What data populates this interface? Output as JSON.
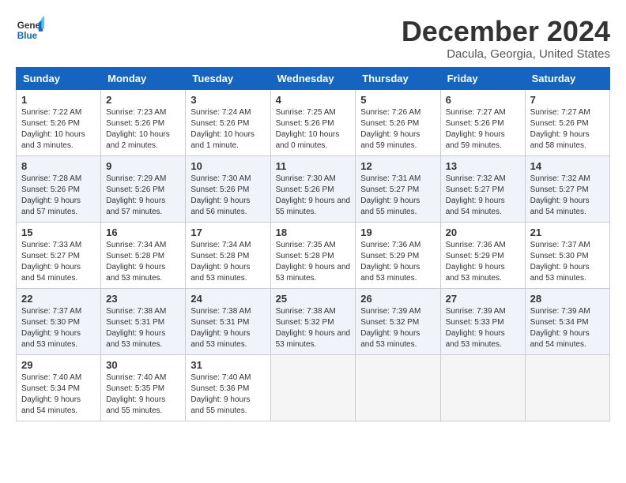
{
  "header": {
    "logo_general": "General",
    "logo_blue": "Blue",
    "month": "December 2024",
    "location": "Dacula, Georgia, United States"
  },
  "days_of_week": [
    "Sunday",
    "Monday",
    "Tuesday",
    "Wednesday",
    "Thursday",
    "Friday",
    "Saturday"
  ],
  "weeks": [
    [
      {
        "day": "1",
        "sunrise": "Sunrise: 7:22 AM",
        "sunset": "Sunset: 5:26 PM",
        "daylight": "Daylight: 10 hours and 3 minutes."
      },
      {
        "day": "2",
        "sunrise": "Sunrise: 7:23 AM",
        "sunset": "Sunset: 5:26 PM",
        "daylight": "Daylight: 10 hours and 2 minutes."
      },
      {
        "day": "3",
        "sunrise": "Sunrise: 7:24 AM",
        "sunset": "Sunset: 5:26 PM",
        "daylight": "Daylight: 10 hours and 1 minute."
      },
      {
        "day": "4",
        "sunrise": "Sunrise: 7:25 AM",
        "sunset": "Sunset: 5:26 PM",
        "daylight": "Daylight: 10 hours and 0 minutes."
      },
      {
        "day": "5",
        "sunrise": "Sunrise: 7:26 AM",
        "sunset": "Sunset: 5:26 PM",
        "daylight": "Daylight: 9 hours and 59 minutes."
      },
      {
        "day": "6",
        "sunrise": "Sunrise: 7:27 AM",
        "sunset": "Sunset: 5:26 PM",
        "daylight": "Daylight: 9 hours and 59 minutes."
      },
      {
        "day": "7",
        "sunrise": "Sunrise: 7:27 AM",
        "sunset": "Sunset: 5:26 PM",
        "daylight": "Daylight: 9 hours and 58 minutes."
      }
    ],
    [
      {
        "day": "8",
        "sunrise": "Sunrise: 7:28 AM",
        "sunset": "Sunset: 5:26 PM",
        "daylight": "Daylight: 9 hours and 57 minutes."
      },
      {
        "day": "9",
        "sunrise": "Sunrise: 7:29 AM",
        "sunset": "Sunset: 5:26 PM",
        "daylight": "Daylight: 9 hours and 57 minutes."
      },
      {
        "day": "10",
        "sunrise": "Sunrise: 7:30 AM",
        "sunset": "Sunset: 5:26 PM",
        "daylight": "Daylight: 9 hours and 56 minutes."
      },
      {
        "day": "11",
        "sunrise": "Sunrise: 7:30 AM",
        "sunset": "Sunset: 5:26 PM",
        "daylight": "Daylight: 9 hours and 55 minutes."
      },
      {
        "day": "12",
        "sunrise": "Sunrise: 7:31 AM",
        "sunset": "Sunset: 5:27 PM",
        "daylight": "Daylight: 9 hours and 55 minutes."
      },
      {
        "day": "13",
        "sunrise": "Sunrise: 7:32 AM",
        "sunset": "Sunset: 5:27 PM",
        "daylight": "Daylight: 9 hours and 54 minutes."
      },
      {
        "day": "14",
        "sunrise": "Sunrise: 7:32 AM",
        "sunset": "Sunset: 5:27 PM",
        "daylight": "Daylight: 9 hours and 54 minutes."
      }
    ],
    [
      {
        "day": "15",
        "sunrise": "Sunrise: 7:33 AM",
        "sunset": "Sunset: 5:27 PM",
        "daylight": "Daylight: 9 hours and 54 minutes."
      },
      {
        "day": "16",
        "sunrise": "Sunrise: 7:34 AM",
        "sunset": "Sunset: 5:28 PM",
        "daylight": "Daylight: 9 hours and 53 minutes."
      },
      {
        "day": "17",
        "sunrise": "Sunrise: 7:34 AM",
        "sunset": "Sunset: 5:28 PM",
        "daylight": "Daylight: 9 hours and 53 minutes."
      },
      {
        "day": "18",
        "sunrise": "Sunrise: 7:35 AM",
        "sunset": "Sunset: 5:28 PM",
        "daylight": "Daylight: 9 hours and 53 minutes."
      },
      {
        "day": "19",
        "sunrise": "Sunrise: 7:36 AM",
        "sunset": "Sunset: 5:29 PM",
        "daylight": "Daylight: 9 hours and 53 minutes."
      },
      {
        "day": "20",
        "sunrise": "Sunrise: 7:36 AM",
        "sunset": "Sunset: 5:29 PM",
        "daylight": "Daylight: 9 hours and 53 minutes."
      },
      {
        "day": "21",
        "sunrise": "Sunrise: 7:37 AM",
        "sunset": "Sunset: 5:30 PM",
        "daylight": "Daylight: 9 hours and 53 minutes."
      }
    ],
    [
      {
        "day": "22",
        "sunrise": "Sunrise: 7:37 AM",
        "sunset": "Sunset: 5:30 PM",
        "daylight": "Daylight: 9 hours and 53 minutes."
      },
      {
        "day": "23",
        "sunrise": "Sunrise: 7:38 AM",
        "sunset": "Sunset: 5:31 PM",
        "daylight": "Daylight: 9 hours and 53 minutes."
      },
      {
        "day": "24",
        "sunrise": "Sunrise: 7:38 AM",
        "sunset": "Sunset: 5:31 PM",
        "daylight": "Daylight: 9 hours and 53 minutes."
      },
      {
        "day": "25",
        "sunrise": "Sunrise: 7:38 AM",
        "sunset": "Sunset: 5:32 PM",
        "daylight": "Daylight: 9 hours and 53 minutes."
      },
      {
        "day": "26",
        "sunrise": "Sunrise: 7:39 AM",
        "sunset": "Sunset: 5:32 PM",
        "daylight": "Daylight: 9 hours and 53 minutes."
      },
      {
        "day": "27",
        "sunrise": "Sunrise: 7:39 AM",
        "sunset": "Sunset: 5:33 PM",
        "daylight": "Daylight: 9 hours and 53 minutes."
      },
      {
        "day": "28",
        "sunrise": "Sunrise: 7:39 AM",
        "sunset": "Sunset: 5:34 PM",
        "daylight": "Daylight: 9 hours and 54 minutes."
      }
    ],
    [
      {
        "day": "29",
        "sunrise": "Sunrise: 7:40 AM",
        "sunset": "Sunset: 5:34 PM",
        "daylight": "Daylight: 9 hours and 54 minutes."
      },
      {
        "day": "30",
        "sunrise": "Sunrise: 7:40 AM",
        "sunset": "Sunset: 5:35 PM",
        "daylight": "Daylight: 9 hours and 55 minutes."
      },
      {
        "day": "31",
        "sunrise": "Sunrise: 7:40 AM",
        "sunset": "Sunset: 5:36 PM",
        "daylight": "Daylight: 9 hours and 55 minutes."
      },
      null,
      null,
      null,
      null
    ]
  ]
}
